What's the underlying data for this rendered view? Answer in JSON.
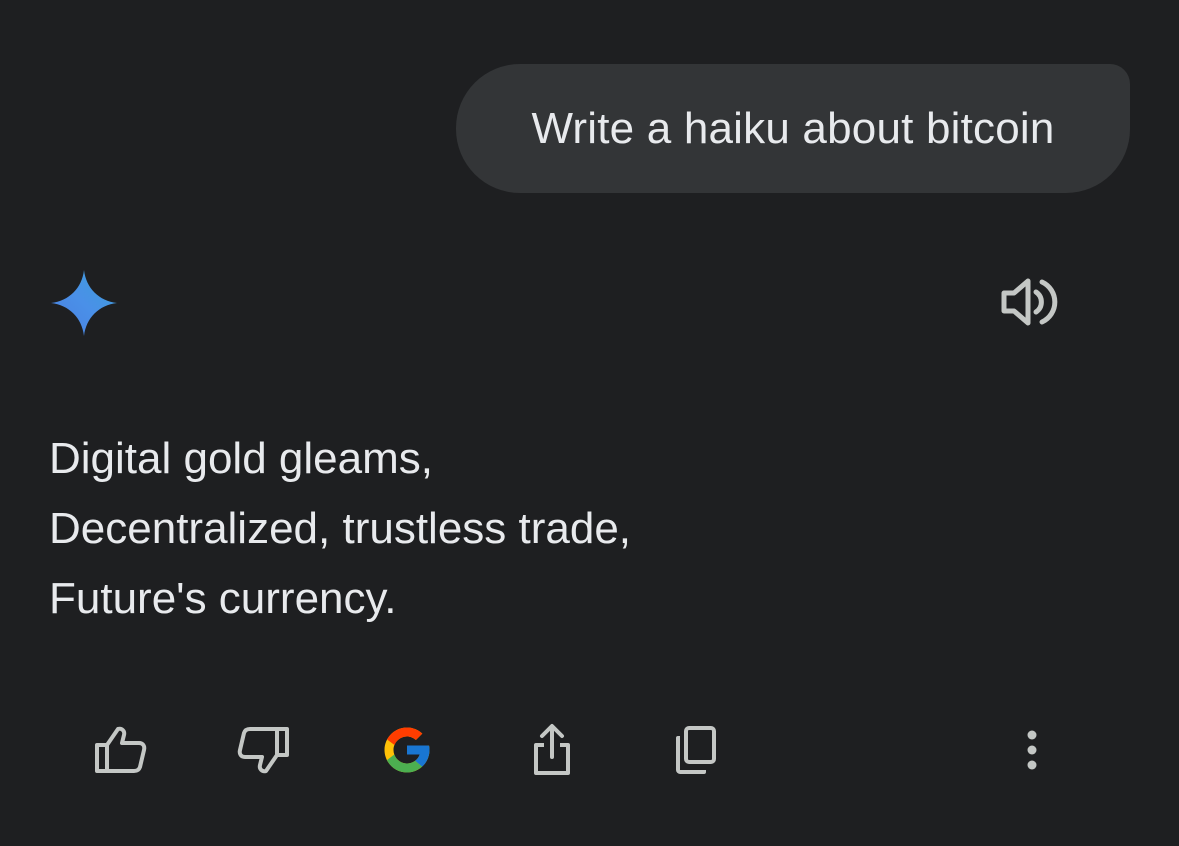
{
  "user_message": {
    "text": "Write a haiku about bitcoin"
  },
  "response": {
    "lines": [
      "Digital gold gleams,",
      "Decentralized, trustless trade,",
      "Future's currency."
    ]
  },
  "icons": {
    "assistant": "gemini-sparkle-icon",
    "speaker": "speaker-icon",
    "actions": [
      "thumbs-up-icon",
      "thumbs-down-icon",
      "google-icon",
      "share-icon",
      "copy-icon",
      "more-vertical-icon"
    ]
  },
  "colors": {
    "background": "#1e1f21",
    "bubble": "#333537",
    "text": "#e8eaed",
    "icon": "#c4c7c5"
  }
}
